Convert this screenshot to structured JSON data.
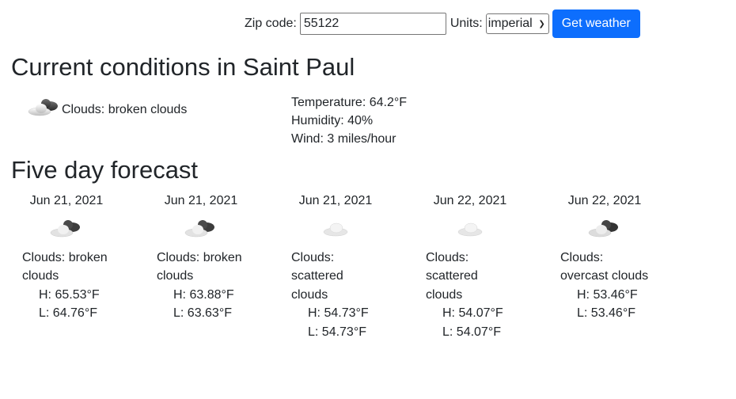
{
  "form": {
    "zip_label": "Zip code:",
    "zip_value": "55122",
    "units_label": "Units:",
    "units_value": "imperial",
    "button_label": "Get weather"
  },
  "current": {
    "title": "Current conditions in Saint Paul",
    "icon": "broken-clouds-icon",
    "description": "Clouds: broken clouds",
    "temperature": "Temperature: 64.2°F",
    "humidity": "Humidity: 40%",
    "wind": "Wind: 3 miles/hour"
  },
  "forecast": {
    "title": "Five day forecast",
    "days": [
      {
        "date": "Jun 21, 2021",
        "icon": "broken-clouds-icon",
        "description": "Clouds: broken clouds",
        "high": "H: 65.53°F",
        "low": "L: 64.76°F"
      },
      {
        "date": "Jun 21, 2021",
        "icon": "broken-clouds-icon",
        "description": "Clouds: broken clouds",
        "high": "H: 63.88°F",
        "low": "L: 63.63°F"
      },
      {
        "date": "Jun 21, 2021",
        "icon": "scattered-clouds-icon",
        "description": "Clouds: scattered clouds",
        "high": "H: 54.73°F",
        "low": "L: 54.73°F"
      },
      {
        "date": "Jun 22, 2021",
        "icon": "scattered-clouds-icon",
        "description": "Clouds: scattered clouds",
        "high": "H: 54.07°F",
        "low": "L: 54.07°F"
      },
      {
        "date": "Jun 22, 2021",
        "icon": "overcast-clouds-icon",
        "description": "Clouds: overcast clouds",
        "high": "H: 53.46°F",
        "low": "L: 53.46°F"
      }
    ]
  },
  "colors": {
    "text": "#212529",
    "button_bg": "#0d6efd",
    "button_text": "#ffffff"
  }
}
